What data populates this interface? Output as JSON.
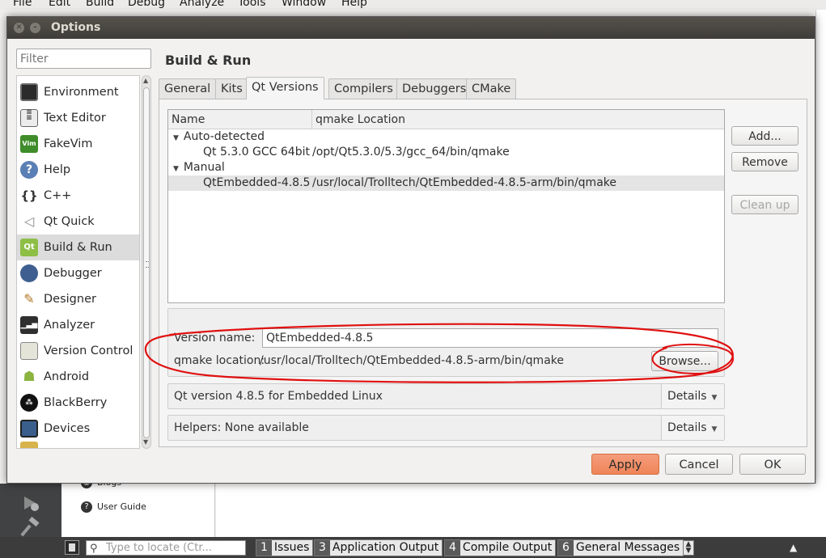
{
  "menubar": {
    "items": [
      "File",
      "Edit",
      "Build",
      "Debug",
      "Analyze",
      "Tools",
      "Window",
      "Help"
    ]
  },
  "dialog": {
    "title": "Options",
    "filter_placeholder": "Filter",
    "page_title": "Build & Run",
    "nav_items": [
      {
        "label": "Environment",
        "icon": "monitor-icon"
      },
      {
        "label": "Text Editor",
        "icon": "text-editor-icon"
      },
      {
        "label": "FakeVim",
        "icon": "fakevim-icon"
      },
      {
        "label": "Help",
        "icon": "help-icon"
      },
      {
        "label": "C++",
        "icon": "cpp-braces-icon"
      },
      {
        "label": "Qt Quick",
        "icon": "qt-quick-icon"
      },
      {
        "label": "Build & Run",
        "icon": "build-run-icon"
      },
      {
        "label": "Debugger",
        "icon": "debugger-icon"
      },
      {
        "label": "Designer",
        "icon": "designer-icon"
      },
      {
        "label": "Analyzer",
        "icon": "analyzer-icon"
      },
      {
        "label": "Version Control",
        "icon": "version-control-icon"
      },
      {
        "label": "Android",
        "icon": "android-icon"
      },
      {
        "label": "BlackBerry",
        "icon": "blackberry-icon"
      },
      {
        "label": "Devices",
        "icon": "devices-icon"
      }
    ],
    "selected_nav": "Build & Run",
    "tabs": [
      "General",
      "Kits",
      "Qt Versions",
      "Compilers",
      "Debuggers",
      "CMake"
    ],
    "active_tab": "Qt Versions",
    "table": {
      "columns": [
        "Name",
        "qmake Location"
      ],
      "groups": [
        {
          "label": "Auto-detected",
          "rows": [
            {
              "name": "Qt 5.3.0 GCC 64bit",
              "location": "/opt/Qt5.3.0/5.3/gcc_64/bin/qmake"
            }
          ]
        },
        {
          "label": "Manual",
          "rows": [
            {
              "name": "QtEmbedded-4.8.5",
              "location": "/usr/local/Trolltech/QtEmbedded-4.8.5-arm/bin/qmake"
            }
          ]
        }
      ]
    },
    "side_buttons": {
      "add": "Add...",
      "remove": "Remove",
      "clean_up": "Clean up"
    },
    "version": {
      "name_label": "Version name:",
      "name_value": "QtEmbedded-4.8.5",
      "qmake_label": "qmake location:",
      "qmake_value": "/usr/local/Trolltech/QtEmbedded-4.8.5-arm/bin/qmake",
      "browse": "Browse..."
    },
    "info_rows": [
      {
        "text": "Qt version 4.8.5 for Embedded Linux",
        "details": "Details"
      },
      {
        "text": "Helpers: None available",
        "details": "Details"
      }
    ],
    "footer": {
      "apply": "Apply",
      "cancel": "Cancel",
      "ok": "OK"
    }
  },
  "welcome": {
    "links": [
      "Blogs",
      "User Guide"
    ]
  },
  "statusbar": {
    "locator_placeholder": "Type to locate (Ctr...",
    "panes": [
      {
        "num": "1",
        "label": "Issues"
      },
      {
        "num": "3",
        "label": "Application Output"
      },
      {
        "num": "4",
        "label": "Compile Output"
      },
      {
        "num": "6",
        "label": "General Messages"
      }
    ]
  },
  "colors": {
    "accent_apply": "#ef8458",
    "selection": "#dcdcdc",
    "annotation": "#e01010",
    "titlebar": "#3f3d39"
  }
}
